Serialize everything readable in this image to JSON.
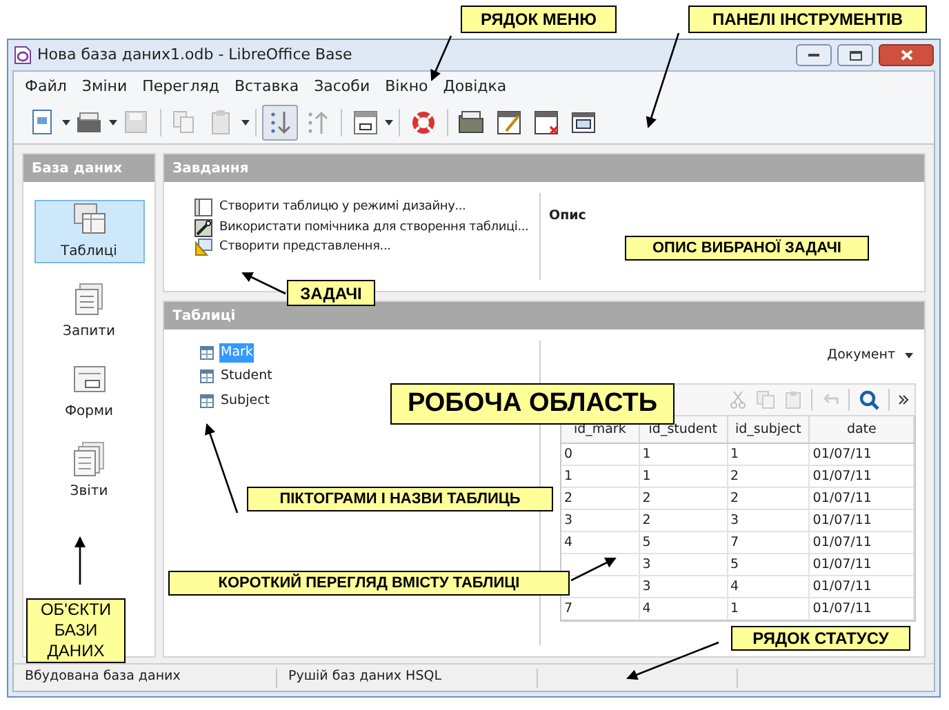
{
  "window": {
    "title": "Нова база даних1.odb - LibreOffice Base"
  },
  "menu": [
    "Файл",
    "Зміни",
    "Перегляд",
    "Вставка",
    "Засоби",
    "Вікно",
    "Довідка"
  ],
  "sidebar": {
    "title": "База даних",
    "items": [
      {
        "label": "Таблиці",
        "kind": "tables",
        "selected": true
      },
      {
        "label": "Запити",
        "kind": "queries",
        "selected": false
      },
      {
        "label": "Форми",
        "kind": "forms",
        "selected": false
      },
      {
        "label": "Звіти",
        "kind": "reports",
        "selected": false
      }
    ]
  },
  "tasks": {
    "title": "Завдання",
    "items": [
      {
        "label": "Створити таблицю у режимі дизайну...",
        "kind": "design"
      },
      {
        "label": "Використати помічника для створення таблиці...",
        "kind": "wizard"
      },
      {
        "label": "Створити представлення...",
        "kind": "view"
      }
    ],
    "description_title": "Опис"
  },
  "tables": {
    "title": "Таблиці",
    "items": [
      {
        "label": "Mark",
        "selected": true
      },
      {
        "label": "Student",
        "selected": false
      },
      {
        "label": "Subject",
        "selected": false
      }
    ],
    "preview_mode": "Документ",
    "preview": {
      "columns": [
        "id_mark",
        "id_student",
        "id_subject",
        "date"
      ],
      "rows": [
        {
          "id_mark": "0",
          "id_student": "1",
          "id_subject": "1",
          "date": "01/07/11"
        },
        {
          "id_mark": "1",
          "id_student": "1",
          "id_subject": "2",
          "date": "01/07/11"
        },
        {
          "id_mark": "2",
          "id_student": "2",
          "id_subject": "2",
          "date": "01/07/11"
        },
        {
          "id_mark": "3",
          "id_student": "2",
          "id_subject": "3",
          "date": "01/07/11"
        },
        {
          "id_mark": "4",
          "id_student": "5",
          "id_subject": "7",
          "date": "01/07/11"
        },
        {
          "id_student": "3",
          "id_subject": "5",
          "date": "01/07/11"
        },
        {
          "id_student": "3",
          "id_subject": "4",
          "date": "01/07/11"
        },
        {
          "id_mark": "7",
          "id_student": "4",
          "id_subject": "1",
          "date": "01/07/11"
        }
      ]
    }
  },
  "status_bar": [
    "Вбудована база даних",
    "Рушій баз даних HSQL"
  ],
  "callouts": [
    {
      "text": "РЯДОК МЕНЮ",
      "kind": "menu"
    },
    {
      "text": "ПАНЕЛІ ІНСТРУМЕНТІВ",
      "kind": "toolbar"
    },
    {
      "text": "ЗАДАЧІ",
      "kind": "tasks"
    },
    {
      "text": "ОПИС ВИБРАНОЇ ЗАДАЧІ",
      "kind": "description"
    },
    {
      "text": "РОБОЧА ОБЛАСТЬ",
      "kind": "workarea"
    },
    {
      "text": "ПІКТОГРАМИ І НАЗВИ ТАБЛИЦЬ",
      "kind": "tableicons"
    },
    {
      "text": "КОРОТКИЙ ПЕРЕГЛЯД ВМІСТУ ТАБЛИЦІ",
      "kind": "preview"
    },
    {
      "text": "ОБ'ЄКТИ БАЗИ ДАНИХ",
      "kind": "objects"
    },
    {
      "text": "РЯДОК СТАТУСУ",
      "kind": "status"
    }
  ]
}
